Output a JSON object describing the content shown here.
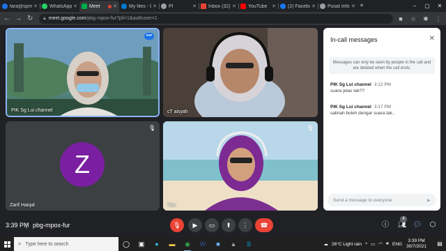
{
  "browser": {
    "tabs": [
      {
        "label": "fara@sprm",
        "favicon_color": "#1a73e8",
        "active": false
      },
      {
        "label": "WhatsApp",
        "favicon_color": "#25d366",
        "active": false
      },
      {
        "label": "Meet",
        "favicon_color": "#00ac47",
        "active": true
      },
      {
        "label": "My files - C",
        "favicon_color": "#0078d4",
        "active": false
      },
      {
        "label": "PI",
        "favicon_color": "#9aa0a6",
        "active": false
      },
      {
        "label": "Inbox (32)",
        "favicon_color": "#ea4335",
        "active": false
      },
      {
        "label": "YouTube",
        "favicon_color": "#ff0000",
        "active": false
      },
      {
        "label": "(2) Facebo",
        "favicon_color": "#1877f2",
        "active": false
      },
      {
        "label": "Pusat Inform",
        "favicon_color": "#9aa0a6",
        "active": false
      }
    ],
    "url_host": "meet.google.com",
    "url_path": "/pbg-mpox-fur?pli=1&authuser=1"
  },
  "participants": [
    {
      "name": "PIK Sg Lui channel"
    },
    {
      "name": "cT aisyah"
    },
    {
      "name": "Zarif Haiqal",
      "initial": "Z",
      "avatar_color": "#7b1fa2"
    },
    {
      "name": "You"
    }
  ],
  "chat": {
    "title": "In-call messages",
    "info": "Messages can only be seen by people in the call and are deleted when the call ends.",
    "messages": [
      {
        "sender": "PIK Sg Lui channel",
        "time": "3:12 PM",
        "text": "suara jelas tak??"
      },
      {
        "sender": "PIK Sg Lui channel",
        "time": "3:17 PM",
        "text": "salinah boleh dengar suara tak.."
      }
    ],
    "input_placeholder": "Send a message to everyone"
  },
  "meeting": {
    "time": "3:39 PM",
    "separator": "|",
    "code": "pbg-mpox-fur",
    "participant_count": "4"
  },
  "taskbar": {
    "search_placeholder": "Type here to search",
    "weather": "26°C  Light rain",
    "language": "ENG",
    "time": "3:39 PM",
    "date": "30/7/2021"
  }
}
